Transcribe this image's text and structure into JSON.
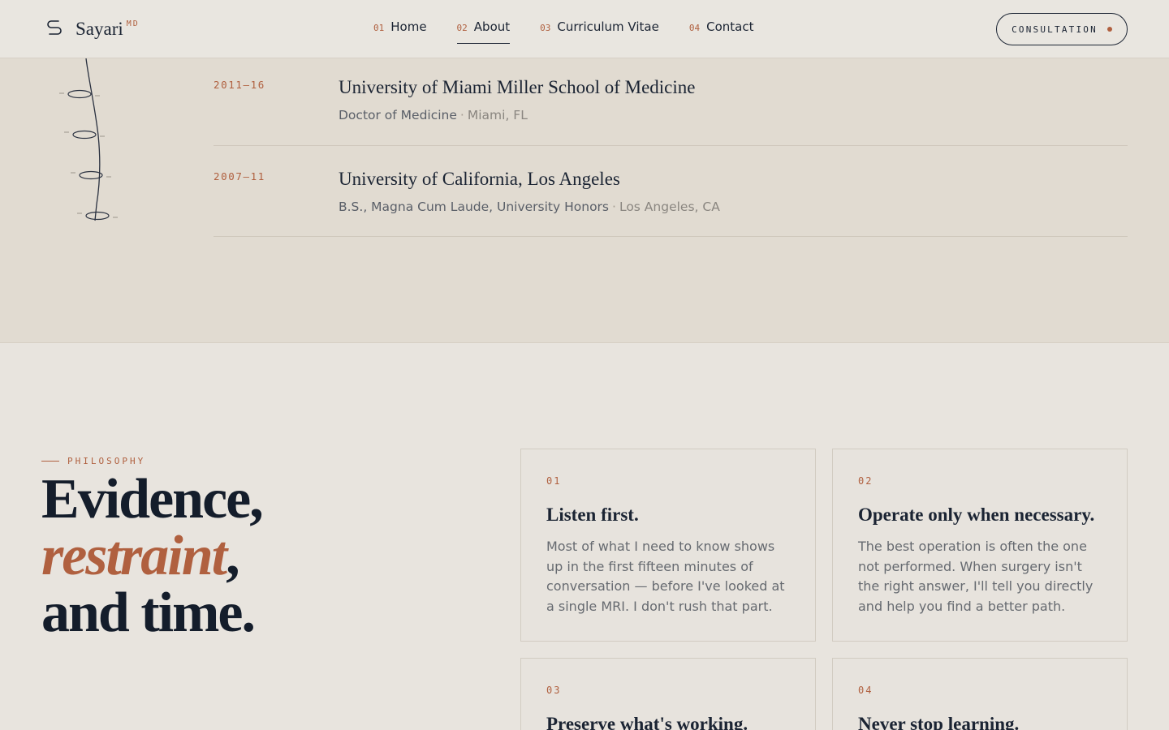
{
  "header": {
    "logo_name": "Sayari",
    "logo_suffix": "MD",
    "nav": [
      {
        "num": "01",
        "label": "Home",
        "active": false
      },
      {
        "num": "02",
        "label": "About",
        "active": true
      },
      {
        "num": "03",
        "label": "Curriculum Vitae",
        "active": false
      },
      {
        "num": "04",
        "label": "Contact",
        "active": false
      }
    ],
    "cta_label": "CONSULTATION"
  },
  "education": [
    {
      "years": "2011–16",
      "school": "University of Miami Miller School of Medicine",
      "degree": "Doctor of Medicine",
      "location": "Miami, FL"
    },
    {
      "years": "2007–11",
      "school": "University of California, Los Angeles",
      "degree": "B.S., Magna Cum Laude, University Honors",
      "location": "Los Angeles, CA"
    }
  ],
  "separator": "·",
  "philosophy": {
    "eyebrow": "PHILOSOPHY",
    "headline_line1": "Evidence,",
    "headline_line2": "restraint",
    "headline_line2_punct": ",",
    "headline_line3": "and time.",
    "cards": [
      {
        "num": "01",
        "title": "Listen first.",
        "body": "Most of what I need to know shows up in the first fifteen minutes of conversation — before I've looked at a single MRI. I don't rush that part."
      },
      {
        "num": "02",
        "title": "Operate only when necessary.",
        "body": "The best operation is often the one not performed. When surgery isn't the right answer, I'll tell you directly and help you find a better path."
      },
      {
        "num": "03",
        "title": "Preserve what's working.",
        "body": ""
      },
      {
        "num": "04",
        "title": "Never stop learning.",
        "body": ""
      }
    ]
  },
  "colors": {
    "accent": "#b0603f",
    "ink": "#1b2433",
    "background": "#e8e4de",
    "band": "#e1dbd1"
  }
}
